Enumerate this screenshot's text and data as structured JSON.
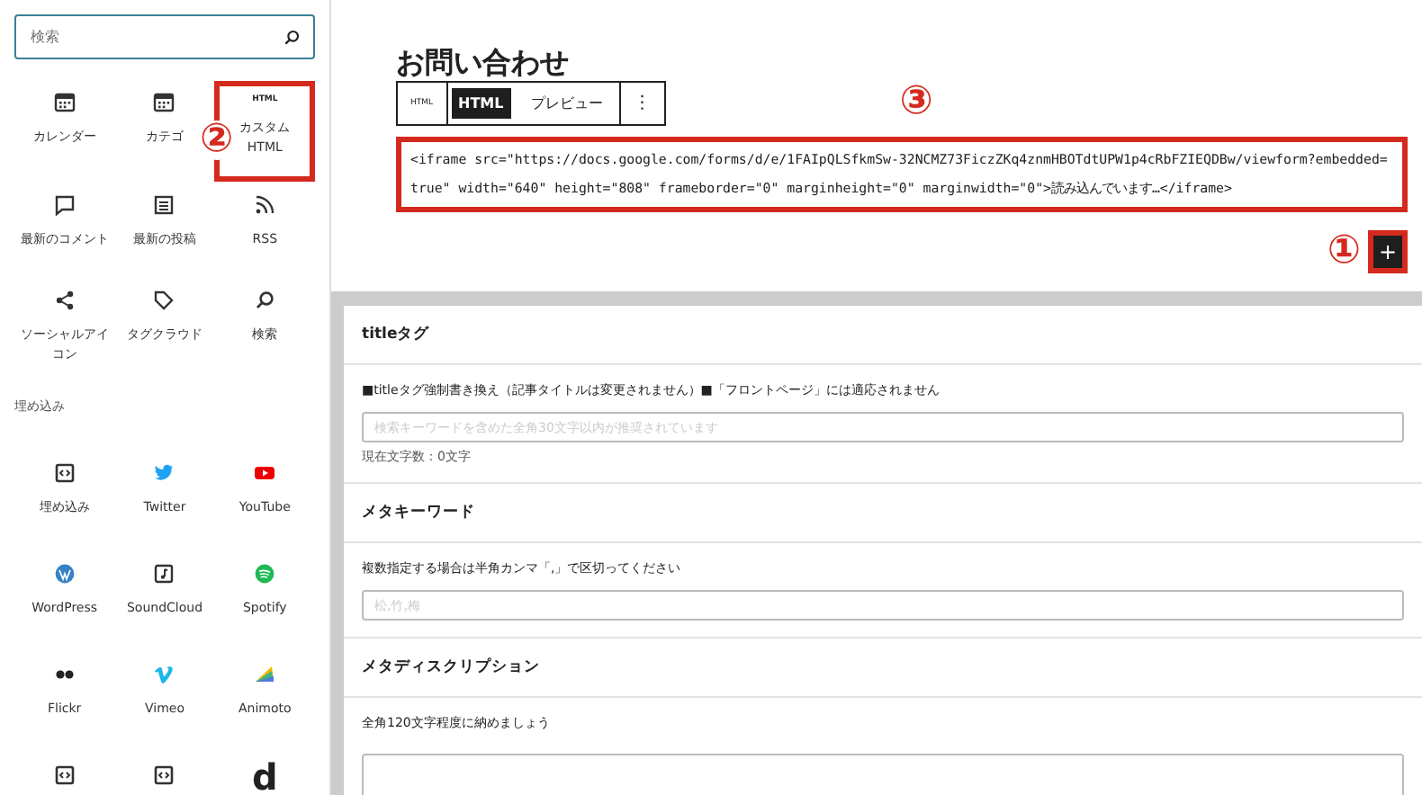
{
  "sidebar": {
    "search": {
      "placeholder": "検索"
    },
    "sections": [
      {
        "blocks": [
          {
            "label": "カレンダー",
            "kind": "calendar",
            "highlighted": false
          },
          {
            "label": "カテゴ",
            "kind": "calendar",
            "highlighted": false
          },
          {
            "label": "カスタムHTML",
            "kind": "html",
            "icon_text": "HTML",
            "highlighted": true
          },
          {
            "label": "最新のコメント",
            "kind": "comment",
            "highlighted": false
          },
          {
            "label": "最新の投稿",
            "kind": "list",
            "highlighted": false
          },
          {
            "label": "RSS",
            "kind": "rss",
            "highlighted": false
          },
          {
            "label": "ソーシャルアイコン",
            "kind": "share",
            "highlighted": false
          },
          {
            "label": "タグクラウド",
            "kind": "tag",
            "highlighted": false
          },
          {
            "label": "検索",
            "kind": "search",
            "highlighted": false
          }
        ]
      },
      {
        "heading": "埋め込み",
        "blocks": [
          {
            "label": "埋め込み",
            "kind": "embed",
            "highlighted": false
          },
          {
            "label": "Twitter",
            "kind": "bird",
            "highlighted": false
          },
          {
            "label": "YouTube",
            "kind": "play",
            "highlighted": false
          },
          {
            "label": "WordPress",
            "kind": "wp",
            "highlighted": false
          },
          {
            "label": "SoundCloud",
            "kind": "note",
            "highlighted": false
          },
          {
            "label": "Spotify",
            "kind": "spotify",
            "highlighted": false
          },
          {
            "label": "Flickr",
            "kind": "dots",
            "highlighted": false
          },
          {
            "label": "Vimeo",
            "kind": "vimeo",
            "highlighted": false
          },
          {
            "label": "Animoto",
            "kind": "animoto",
            "highlighted": false
          },
          {
            "kind": "embed",
            "highlighted": false
          },
          {
            "kind": "embed",
            "highlighted": false
          },
          {
            "kind": "dletter",
            "icon_text": "d",
            "highlighted": false
          }
        ]
      }
    ]
  },
  "annotations": [
    "①",
    "②",
    "③"
  ],
  "editor": {
    "heading": "お問い合わせ",
    "toolbar": {
      "block_icon": "HTML",
      "tabs": [
        {
          "label": "HTML",
          "selected": true
        },
        {
          "label": "プレビュー",
          "selected": false
        }
      ],
      "more": "⋮"
    },
    "code": "<iframe src=\"https://docs.google.com/forms/d/e/1FAIpQLSfkmSw-32NCMZ73FiczZKq4znmHBOTdtUPW1p4cRbFZIEQDBw/viewform?embedded=true\" width=\"640\" height=\"808\" frameborder=\"0\" marginheight=\"0\" marginwidth=\"0\">読み込んでいます…</iframe>",
    "add_button": "+"
  },
  "seo": [
    {
      "title": "titleタグ",
      "note": "■titleタグ強制書き換え（記事タイトルは変更されません）■「フロントページ」には適応されません",
      "field": {
        "kind": "input",
        "placeholder": "検索キーワードを含めた全角30文字以内が推奨されています"
      },
      "counter": "現在文字数：0文字"
    },
    {
      "title": "メタキーワード",
      "note": "複数指定する場合は半角カンマ「,」で区切ってください",
      "field": {
        "kind": "input",
        "placeholder": "松,竹,梅"
      }
    },
    {
      "title": "メタディスクリプション",
      "note": "全角120文字程度に納めましょう",
      "field": {
        "kind": "textarea"
      }
    }
  ]
}
